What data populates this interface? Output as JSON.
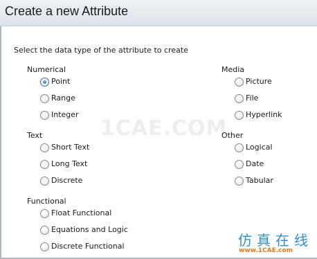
{
  "header": {
    "title": "Create a new Attribute"
  },
  "instruction": "Select the data type of the attribute to create",
  "groups": {
    "numerical": {
      "label": "Numerical",
      "options": [
        "Point",
        "Range",
        "Integer"
      ]
    },
    "media": {
      "label": "Media",
      "options": [
        "Picture",
        "File",
        "Hyperlink"
      ]
    },
    "text": {
      "label": "Text",
      "options": [
        "Short Text",
        "Long Text",
        "Discrete"
      ]
    },
    "other": {
      "label": "Other",
      "options": [
        "Logical",
        "Date",
        "Tabular"
      ]
    },
    "functional": {
      "label": "Functional",
      "options": [
        "Float Functional",
        "Equations and Logic",
        "Discrete Functional"
      ]
    }
  },
  "selected": "Point",
  "watermark": {
    "center": "1CAE.COM",
    "cn": "仿真在线",
    "url": "www.1CAE.com"
  },
  "colors": {
    "accent": "#1f5fa6",
    "header_bg": "#dde3ea",
    "watermark_cn": "#2f8fc8",
    "watermark_url": "#e07a1a"
  }
}
